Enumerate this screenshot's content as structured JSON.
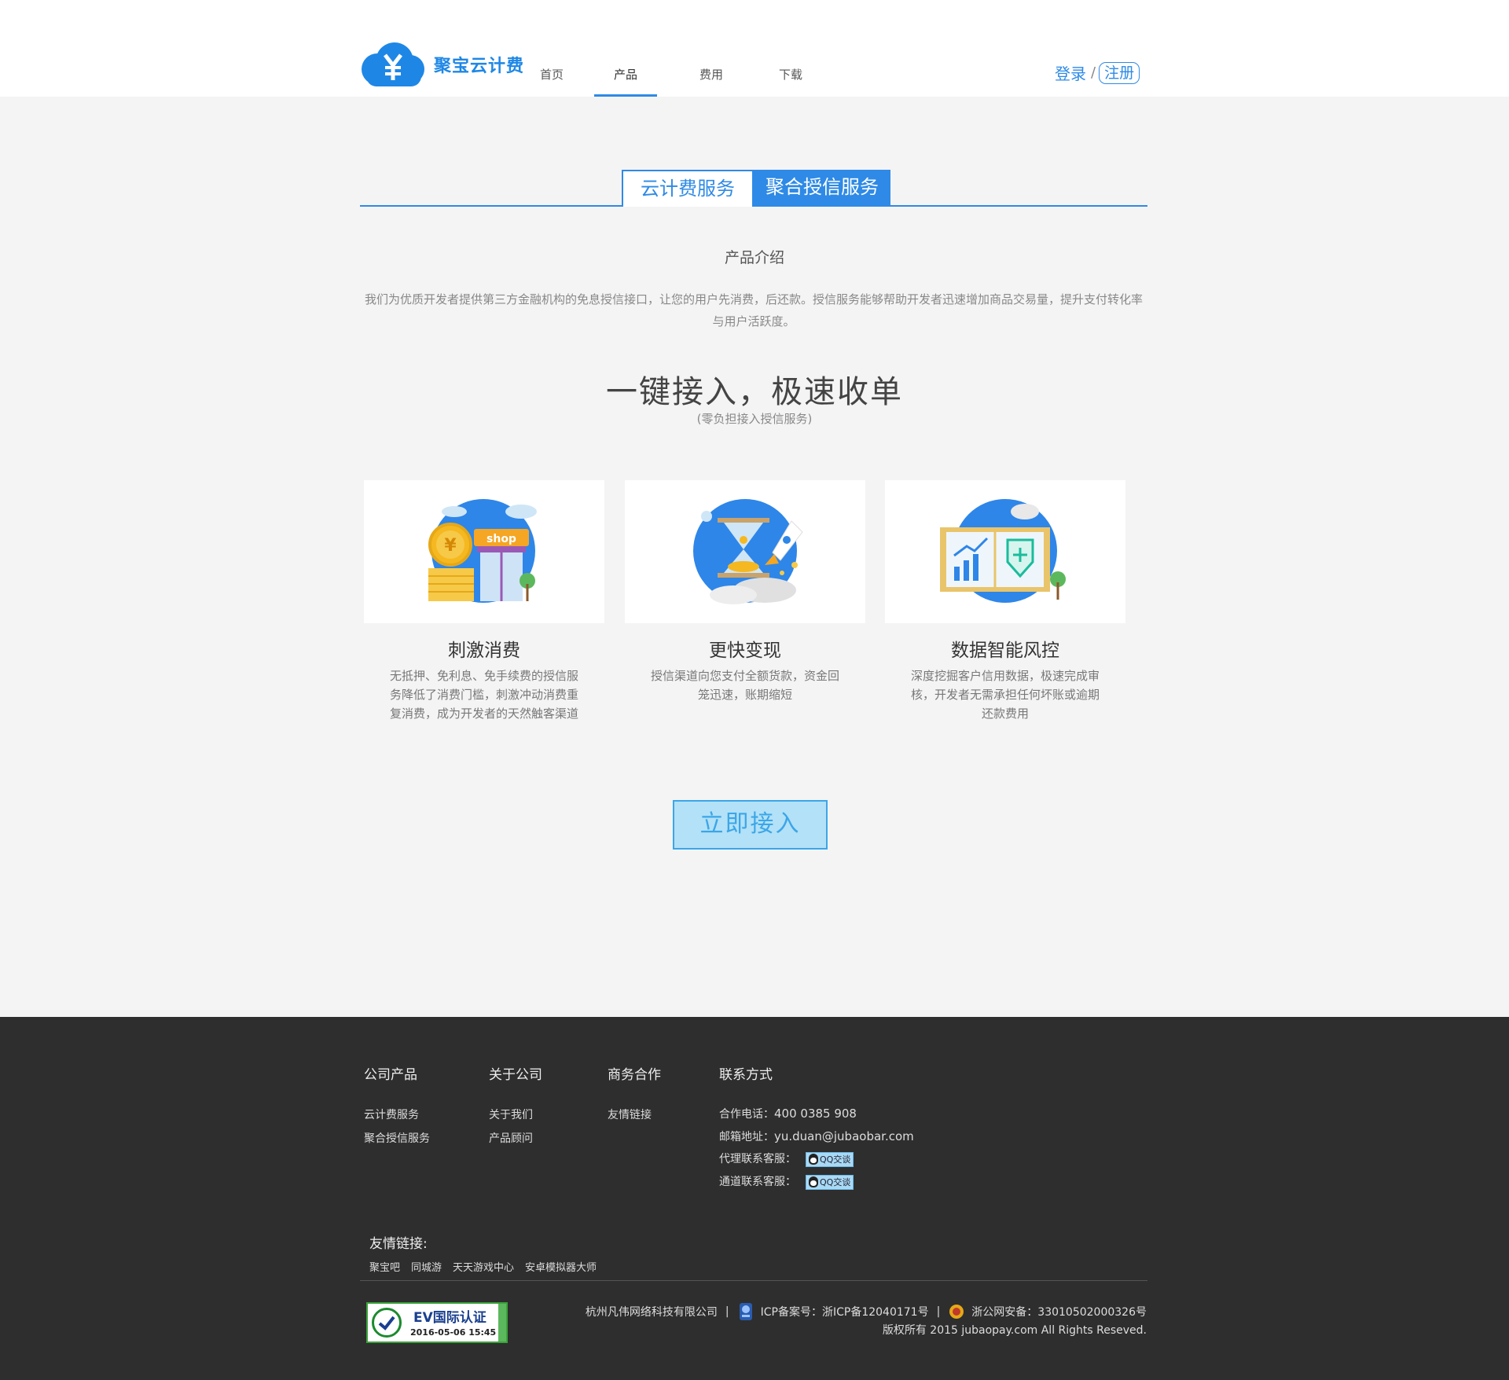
{
  "brand": {
    "name": "聚宝云计费",
    "color": "#1e87e6"
  },
  "nav": {
    "items": [
      {
        "label": "首页"
      },
      {
        "label": "产品",
        "active": true
      },
      {
        "label": "费用"
      },
      {
        "label": "下载"
      }
    ]
  },
  "auth": {
    "login": "登录",
    "separator": "/",
    "register": "注册"
  },
  "tabs": {
    "cloud_billing": "云计费服务",
    "credit_service": "聚合授信服务",
    "active": "credit_service"
  },
  "intro": {
    "title": "产品介绍",
    "text": "我们为优质开发者提供第三方金融机构的免息授信接口，让您的用户先消费，后还款。授信服务能够帮助开发者迅速增加商品交易量，提升支付转化率与用户活跃度。"
  },
  "hero": {
    "headline": "一键接入，极速收单",
    "subheadline": "(零负担接入授信服务)"
  },
  "features": [
    {
      "icon": "shop-coins-icon",
      "title": "刺激消费",
      "desc": "无抵押、免利息、免手续费的授信服务降低了消费门槛，刺激冲动消费重复消费，成为开发者的天然触客渠道"
    },
    {
      "icon": "hourglass-rocket-icon",
      "title": "更快变现",
      "desc": "授信渠道向您支付全额货款，资金回笼迅速，账期缩短"
    },
    {
      "icon": "chart-shield-icon",
      "title": "数据智能风控",
      "desc": "深度挖掘客户信用数据，极速完成审核，开发者无需承担任何坏账或逾期还款费用"
    }
  ],
  "cta": {
    "label": "立即接入"
  },
  "footer": {
    "columns": [
      {
        "title": "公司产品",
        "links": [
          "云计费服务",
          "聚合授信服务"
        ]
      },
      {
        "title": "关于公司",
        "links": [
          "关于我们",
          "产品顾问"
        ]
      },
      {
        "title": "商务合作",
        "links": [
          "友情链接"
        ]
      },
      {
        "title": "联系方式"
      }
    ],
    "contact": {
      "phone_label": "合作电话：",
      "phone": "400 0385 908",
      "email_label": "邮箱地址：",
      "email": "yu.duan@jubaobar.com",
      "agent_label": "代理联系客服：",
      "channel_label": "通道联系客服：",
      "qq_label": "QQ交谈"
    },
    "friends": {
      "title": "友情链接:",
      "links": [
        "聚宝吧",
        "同城游",
        "天天游戏中心",
        "安卓模拟器大师"
      ]
    },
    "ev": {
      "title": "EV国际认证",
      "date": "2016-05-06 15:45"
    },
    "company": "杭州凡伟网络科技有限公司",
    "icp": "ICP备案号：浙ICP备12040171号",
    "police": "浙公网安备：33010502000326号",
    "copyright": "版权所有 2015 jubaopay.com All Rights Reseved."
  }
}
